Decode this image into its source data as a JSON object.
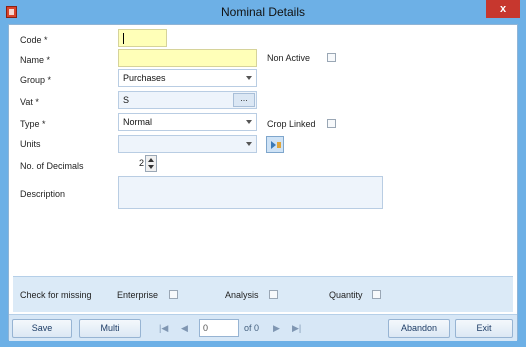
{
  "window": {
    "title": "Nominal Details",
    "close_label": "x"
  },
  "form": {
    "code_label": "Code *",
    "code_value": "",
    "name_label": "Name *",
    "name_value": "",
    "non_active_label": "Non Active",
    "non_active_checked": false,
    "group_label": "Group *",
    "group_value": "Purchases",
    "vat_label": "Vat *",
    "vat_value": "S",
    "vat_lookup_label": "...",
    "type_label": "Type *",
    "type_value": "Normal",
    "crop_linked_label": "Crop Linked",
    "crop_linked_checked": false,
    "units_label": "Units",
    "units_value": "",
    "decimals_label": "No. of Decimals",
    "decimals_value": "2",
    "description_label": "Description",
    "description_value": ""
  },
  "check_missing": {
    "label": "Check for missing",
    "enterprise_label": "Enterprise",
    "analysis_label": "Analysis",
    "quantity_label": "Quantity"
  },
  "toolbar": {
    "save_label": "Save",
    "multi_label": "Multi",
    "first_icon": "|◀",
    "prev_icon": "◀",
    "page_value": "0",
    "of_label": "of 0",
    "next_icon": "▶",
    "last_icon": "▶|",
    "abandon_label": "Abandon",
    "exit_label": "Exit"
  },
  "colors": {
    "title_bar": "#6db0e6",
    "required_field": "#ffffb8",
    "close_button": "#c7372e"
  }
}
